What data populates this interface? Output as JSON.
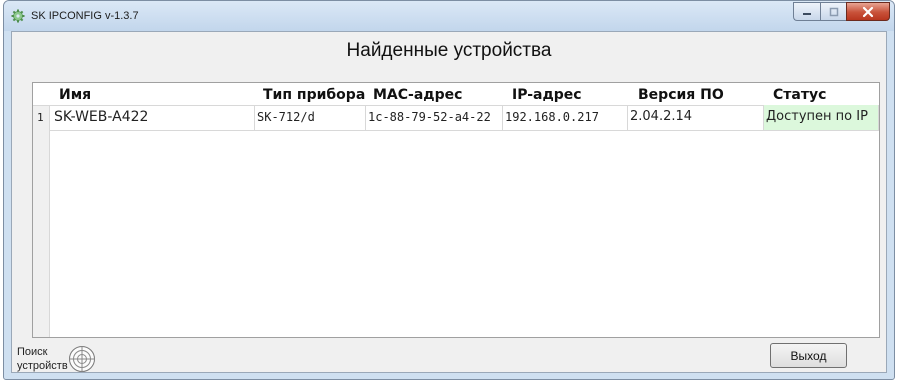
{
  "window": {
    "title": "SK IPCONFIG v-1.3.7"
  },
  "main": {
    "heading": "Найденные устройства"
  },
  "table": {
    "columns": [
      "Имя",
      "Тип прибора",
      "МАС-адрес",
      "IP-адрес",
      "Версия ПО",
      "Статус"
    ],
    "rows": [
      {
        "num": "1",
        "name": "SK-WEB-A422",
        "type": "SK-712/d",
        "mac": "1c-88-79-52-a4-22",
        "ip": "192.168.0.217",
        "version": "2.04.2.14",
        "status": "Доступен по IP"
      }
    ]
  },
  "footer": {
    "search_label": "Поиск устройств",
    "exit_label": "Выход"
  },
  "colors": {
    "status_available": "#dcf8dc",
    "close_button": "#c8523a"
  }
}
